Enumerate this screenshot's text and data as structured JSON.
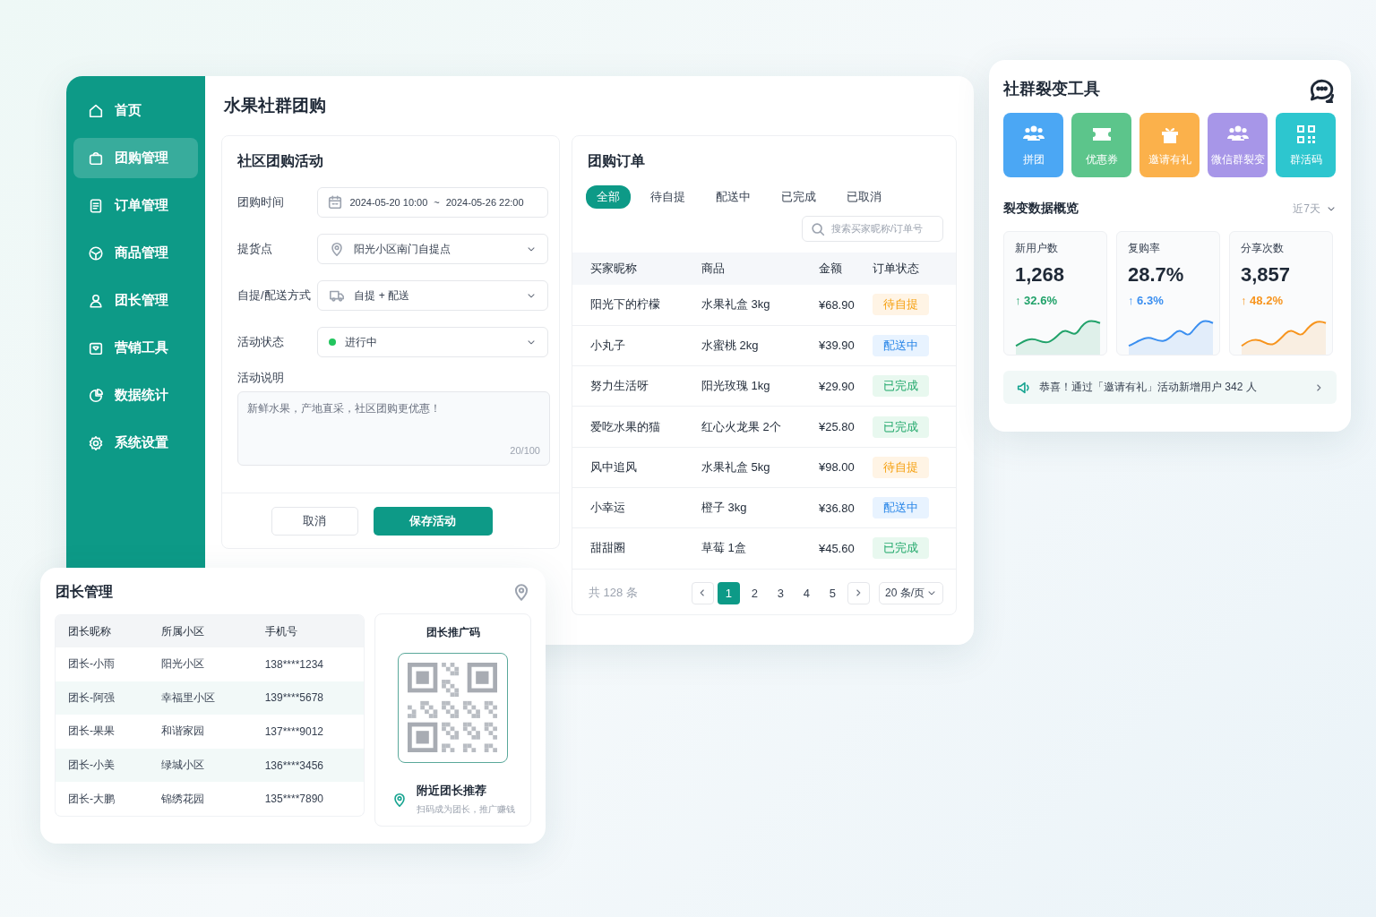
{
  "sidebar": {
    "items": [
      {
        "label": "首页",
        "selected": false
      },
      {
        "label": "团购管理",
        "selected": true
      },
      {
        "label": "订单管理",
        "selected": false
      },
      {
        "label": "商品管理",
        "selected": false
      },
      {
        "label": "团长管理",
        "selected": false
      },
      {
        "label": "营销工具",
        "selected": false
      },
      {
        "label": "数据统计",
        "selected": false
      },
      {
        "label": "系统设置",
        "selected": false
      }
    ]
  },
  "main": {
    "title": "水果社群团购",
    "activity_form": {
      "title": "社区团购活动",
      "fields": [
        {
          "kind": "date_range",
          "label": "团购时间",
          "start": "2024-05-20 10:00",
          "separator": "~",
          "end": "2024-05-26 22:00"
        },
        {
          "kind": "location_select",
          "label": "提货点",
          "value": "阳光小区南门自提点"
        },
        {
          "kind": "delivery_select",
          "label": "自提/配送方式",
          "value": "自提 + 配送"
        },
        {
          "kind": "status",
          "label": "活动状态",
          "value": "进行中",
          "color": "#22c55e"
        }
      ],
      "description": {
        "label": "活动说明",
        "placeholder": "新鲜水果，产地直采，社区团购更优惠！",
        "counter": "20/100"
      },
      "buttons": [
        {
          "kind": "secondary",
          "label": "取消"
        },
        {
          "kind": "primary",
          "label": "保存活动"
        }
      ]
    },
    "orders": {
      "title": "团购订单",
      "tabs": [
        {
          "label": "全部",
          "selected": true
        },
        {
          "label": "待自提",
          "selected": false
        },
        {
          "label": "配送中",
          "selected": false
        },
        {
          "label": "已完成",
          "selected": false
        },
        {
          "label": "已取消",
          "selected": false
        }
      ],
      "search": {
        "placeholder": "搜索买家昵称/订单号"
      },
      "table": {
        "columns": [
          "买家昵称",
          "商品",
          "金额",
          "订单状态"
        ],
        "rows": [
          {
            "buyer": "阳光下的柠檬",
            "product": "水果礼盒 3kg",
            "amount": "¥68.90",
            "status": {
              "kind": "pending",
              "label": "待自提"
            }
          },
          {
            "buyer": "小丸子",
            "product": "水蜜桃 2kg",
            "amount": "¥39.90",
            "status": {
              "kind": "shipping",
              "label": "配送中"
            }
          },
          {
            "buyer": "努力生活呀",
            "product": "阳光玫瑰 1kg",
            "amount": "¥29.90",
            "status": {
              "kind": "done",
              "label": "已完成"
            }
          },
          {
            "buyer": "爱吃水果的猫",
            "product": "红心火龙果 2个",
            "amount": "¥25.80",
            "status": {
              "kind": "done",
              "label": "已完成"
            }
          },
          {
            "buyer": "风中追风",
            "product": "水果礼盒 5kg",
            "amount": "¥98.00",
            "status": {
              "kind": "pending",
              "label": "待自提"
            }
          },
          {
            "buyer": "小幸运",
            "product": "橙子 3kg",
            "amount": "¥36.80",
            "status": {
              "kind": "shipping",
              "label": "配送中"
            }
          },
          {
            "buyer": "甜甜圈",
            "product": "草莓 1盒",
            "amount": "¥45.60",
            "status": {
              "kind": "done",
              "label": "已完成"
            }
          }
        ]
      },
      "pagination": {
        "total": "共 128 条",
        "pages": [
          {
            "label": "1",
            "selected": true
          },
          {
            "label": "2",
            "selected": false
          },
          {
            "label": "3",
            "selected": false
          },
          {
            "label": "4",
            "selected": false
          },
          {
            "label": "5",
            "selected": false
          }
        ],
        "page_size": "20 条/页"
      }
    }
  },
  "leaders": {
    "title": "团长管理",
    "table": {
      "columns": [
        "团长昵称",
        "所属小区",
        "手机号"
      ],
      "rows": [
        [
          "团长-小雨",
          "阳光小区",
          "138****1234"
        ],
        [
          "团长-阿强",
          "幸福里小区",
          "139****5678"
        ],
        [
          "团长-果果",
          "和谐家园",
          "137****9012"
        ],
        [
          "团长-小美",
          "绿城小区",
          "136****3456"
        ],
        [
          "团长-大鹏",
          "锦绣花园",
          "135****7890"
        ]
      ]
    },
    "promo": {
      "title": "团长推广码",
      "nearby_title": "附近团长推荐",
      "nearby_subtitle": "扫码成为团长，推广赚钱"
    }
  },
  "fission": {
    "title": "社群裂变工具",
    "tools": [
      {
        "label": "拼团",
        "color": "#4ba7f4"
      },
      {
        "label": "优惠券",
        "color": "#5cc58b"
      },
      {
        "label": "邀请有礼",
        "color": "#fbb14b"
      },
      {
        "label": "微信群裂变",
        "color": "#a796e8"
      },
      {
        "label": "群活码",
        "color": "#2dc6cf"
      }
    ],
    "overview": {
      "title": "裂变数据概览",
      "range": "近7天",
      "stats": [
        {
          "label": "新用户数",
          "value": "1,268",
          "change": "↑ 32.6%",
          "color": "#21a26a"
        },
        {
          "label": "复购率",
          "value": "28.7%",
          "change": "↑ 6.3%",
          "color": "#3b8ff0"
        },
        {
          "label": "分享次数",
          "value": "3,857",
          "change": "↑ 48.2%",
          "color": "#f7941d"
        }
      ]
    },
    "notice": "恭喜！通过「邀请有礼」活动新增用户 342 人"
  }
}
